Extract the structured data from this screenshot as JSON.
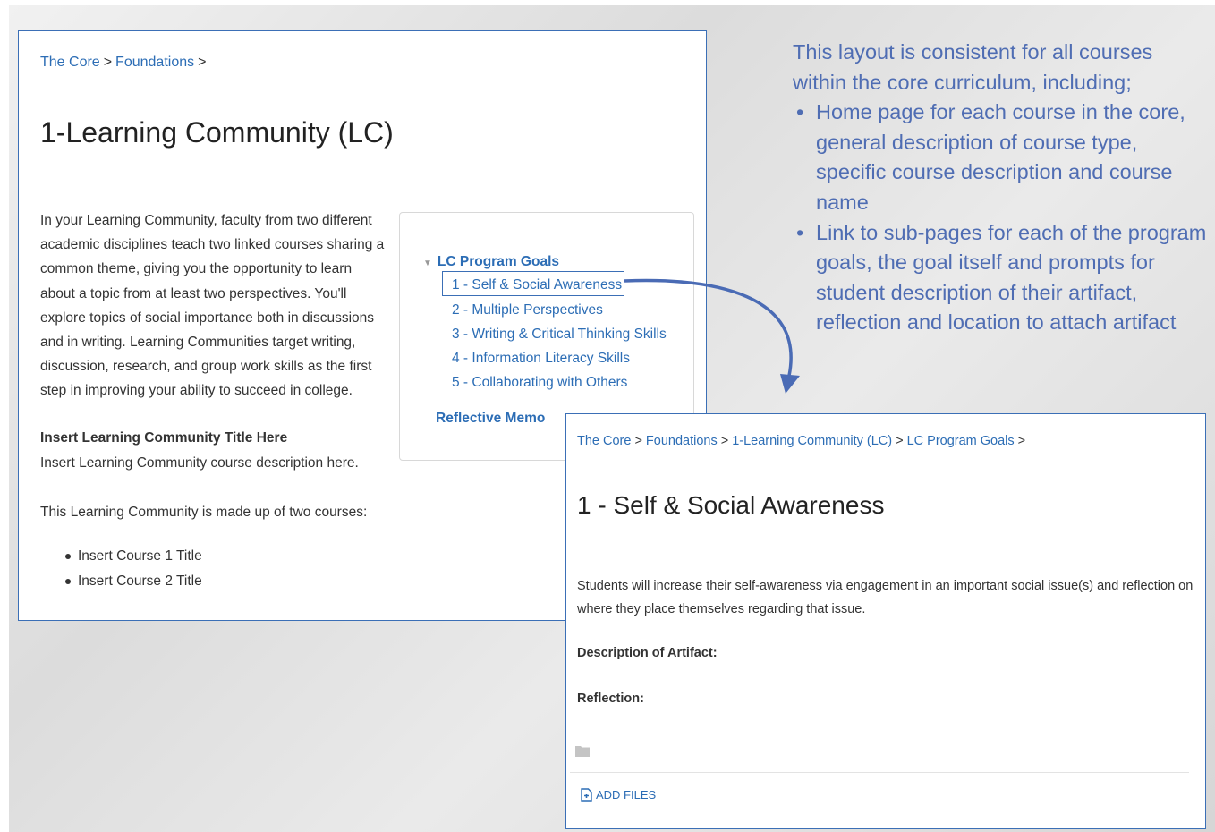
{
  "left_page": {
    "breadcrumb": [
      "The Core",
      "Foundations"
    ],
    "breadcrumb_sep": ">",
    "title": "1-Learning Community (LC)",
    "body": "In your Learning Community, faculty from two different academic disciplines teach two linked courses sharing a common theme, giving you the opportunity to learn about a topic from at least two perspectives. You'll explore topics of social importance both in discussions and in writing. Learning Communities target writing, discussion, research, and group work skills as the first step in improving your ability to succeed in college.",
    "lc_title_placeholder": "Insert Learning Community Title Here",
    "lc_desc_placeholder": "Insert Learning Community course description here.",
    "made_up_text": "This Learning Community is made up of two courses:",
    "courses": [
      "Insert Course 1 Title",
      "Insert Course 2 Title"
    ],
    "goals_nav": {
      "header": "LC Program Goals",
      "items": [
        "1 - Self & Social Awareness",
        "2 - Multiple Perspectives",
        "3 - Writing & Critical Thinking Skills",
        "4 - Information Literacy Skills",
        "5 - Collaborating with Others"
      ],
      "memo": "Reflective Memo"
    }
  },
  "callout": {
    "intro": [
      "This layout is consistent for all courses",
      "within the core curriculum, including;"
    ],
    "bullets": [
      "Home page for each course in the core, general description of course type, specific course description and course name",
      "Link to sub-pages for each of the program goals, the goal itself and prompts for student description of their artifact, reflection and location to attach artifact"
    ]
  },
  "right_page": {
    "breadcrumb": [
      "The Core",
      "Foundations",
      "1-Learning Community (LC)",
      "LC Program Goals"
    ],
    "breadcrumb_sep": ">",
    "title": "1 - Self & Social Awareness",
    "body": "Students will increase their self-awareness via engagement in an important social issue(s) and reflection on where they place themselves regarding that issue.",
    "artifact_label": "Description of Artifact:",
    "reflection_label": "Reflection:",
    "add_files": "ADD FILES"
  },
  "colors": {
    "link": "#2c6db5",
    "accent_border": "#3b6fb6",
    "callout_text": "#4f6db3"
  }
}
